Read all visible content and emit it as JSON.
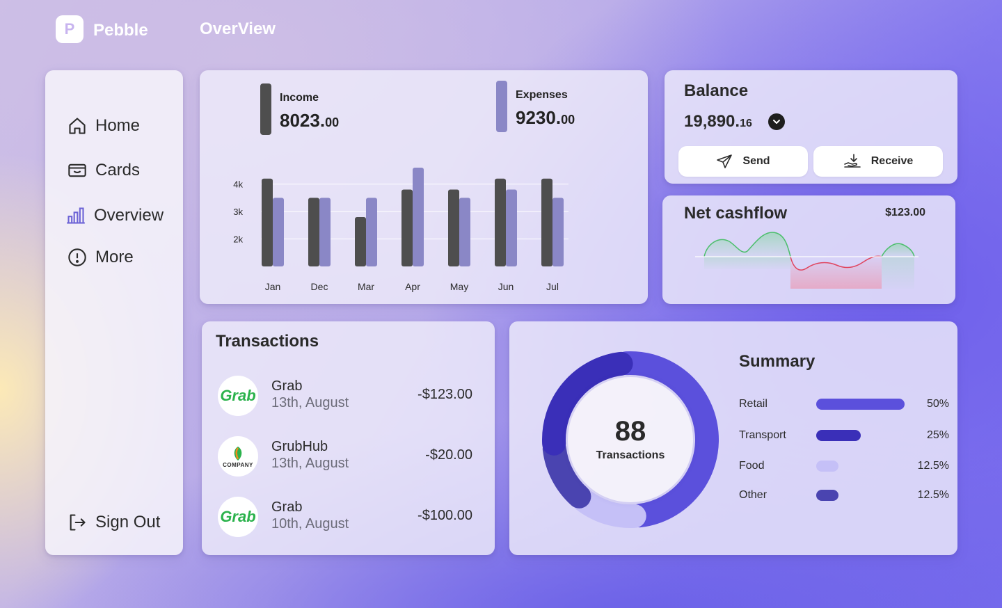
{
  "app": {
    "name": "Pebble",
    "logo_letter": "P",
    "page_title": "OverView"
  },
  "sidebar": {
    "items": [
      {
        "label": "Home",
        "icon": "home-icon"
      },
      {
        "label": "Cards",
        "icon": "card-icon"
      },
      {
        "label": "Overview",
        "icon": "bar-chart-icon"
      },
      {
        "label": "More",
        "icon": "info-icon"
      }
    ],
    "sign_out": {
      "label": "Sign Out",
      "icon": "sign-out-icon"
    }
  },
  "income_expense": {
    "income": {
      "label": "Income",
      "value": "8023.",
      "cents": "00",
      "color": "#4e4e4e"
    },
    "expenses": {
      "label": "Expenses",
      "value": "9230.",
      "cents": "00",
      "color": "#8a87c6"
    }
  },
  "chart_data": {
    "type": "bar",
    "categories": [
      "Jan",
      "Dec",
      "Mar",
      "Apr",
      "May",
      "Jun",
      "Jul"
    ],
    "series": [
      {
        "name": "Income",
        "color": "#4e4e4e",
        "values": [
          4200,
          3500,
          2800,
          3800,
          3800,
          4200,
          4200
        ]
      },
      {
        "name": "Expenses",
        "color": "#8a87c6",
        "values": [
          3500,
          3500,
          3500,
          4600,
          3500,
          3800,
          3500
        ]
      }
    ],
    "yticks": [
      "4k",
      "3k",
      "2k"
    ],
    "ytick_values": [
      4000,
      3000,
      2000
    ],
    "ylim": [
      1000,
      4600
    ],
    "grid": true
  },
  "balance": {
    "title": "Balance",
    "amount": "19,890.",
    "cents": "16",
    "send_label": "Send",
    "receive_label": "Receive"
  },
  "cashflow": {
    "title": "Net cashflow",
    "amount": "$123.00"
  },
  "transactions": {
    "title": "Transactions",
    "items": [
      {
        "merchant": "Grab",
        "date": "13th, August",
        "amount": "-$123.00",
        "logo_text": "Grab",
        "logo_color": "#2bb24c"
      },
      {
        "merchant": "GrubHub",
        "date": "13th, August",
        "amount": "-$20.00",
        "logo_text": "COMPANY",
        "logo_color": "#2a2a2a"
      },
      {
        "merchant": "Grab",
        "date": "10th, August",
        "amount": "-$100.00",
        "logo_text": "Grab",
        "logo_color": "#2bb24c"
      }
    ]
  },
  "summary": {
    "title": "Summary",
    "total_count": "88",
    "total_label": "Transactions",
    "categories": [
      {
        "label": "Retail",
        "pct_text": "50%",
        "share": 0.5,
        "color": "#5b50dc"
      },
      {
        "label": "Transport",
        "pct_text": "25%",
        "share": 0.25,
        "color": "#3a2fb8"
      },
      {
        "label": "Food",
        "pct_text": "12.5%",
        "share": 0.125,
        "color": "#c5c0f7"
      },
      {
        "label": "Other",
        "pct_text": "12.5%",
        "share": 0.125,
        "color": "#4a44b0"
      }
    ]
  }
}
